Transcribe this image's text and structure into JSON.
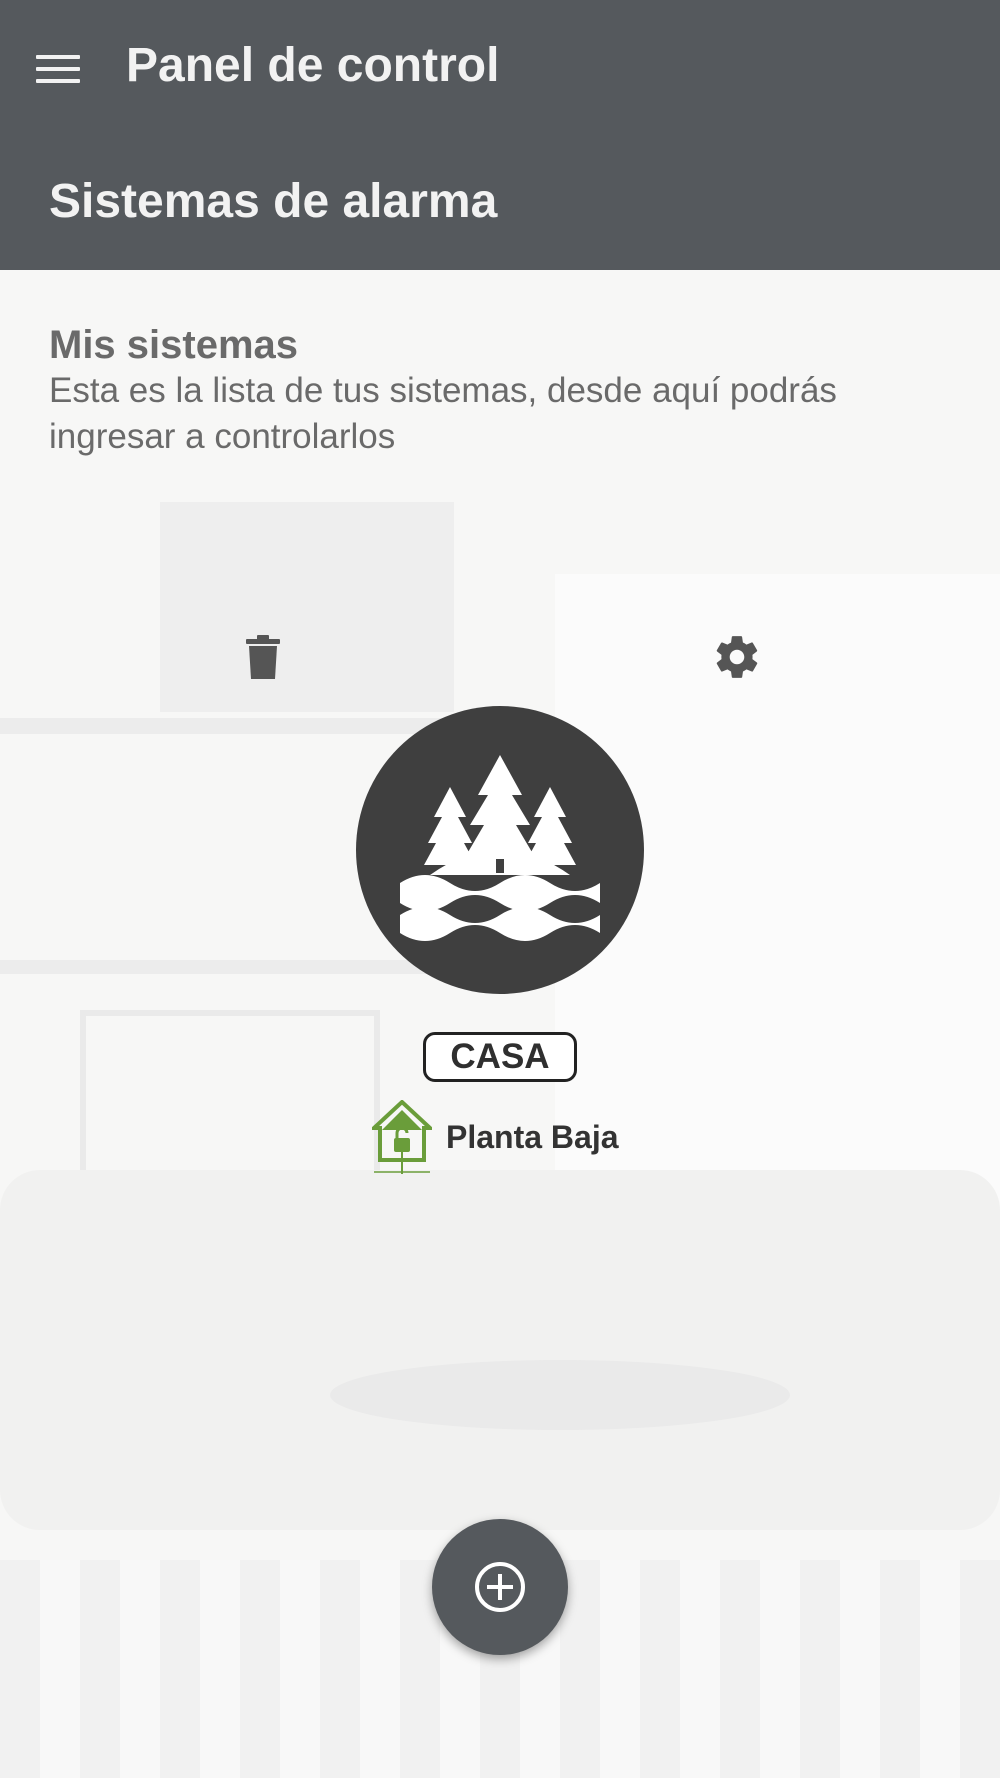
{
  "appbar": {
    "title": "Panel de control",
    "section": "Sistemas de alarma",
    "menu_icon": "hamburger-menu-icon",
    "background": "#55595d"
  },
  "intro": {
    "heading": "Mis sistemas",
    "description": "Esta es la lista de tus sistemas, desde aquí podrás ingresar a controlarlos"
  },
  "system": {
    "name": "CASA",
    "avatar_icon": "forest-lake-icon",
    "delete_icon": "trash-icon",
    "settings_icon": "gear-icon",
    "partition": {
      "label": "Planta Baja",
      "icon": "house-lock-icon",
      "status_color": "#6a9d3a"
    }
  },
  "fab": {
    "icon": "add-circle-icon"
  }
}
